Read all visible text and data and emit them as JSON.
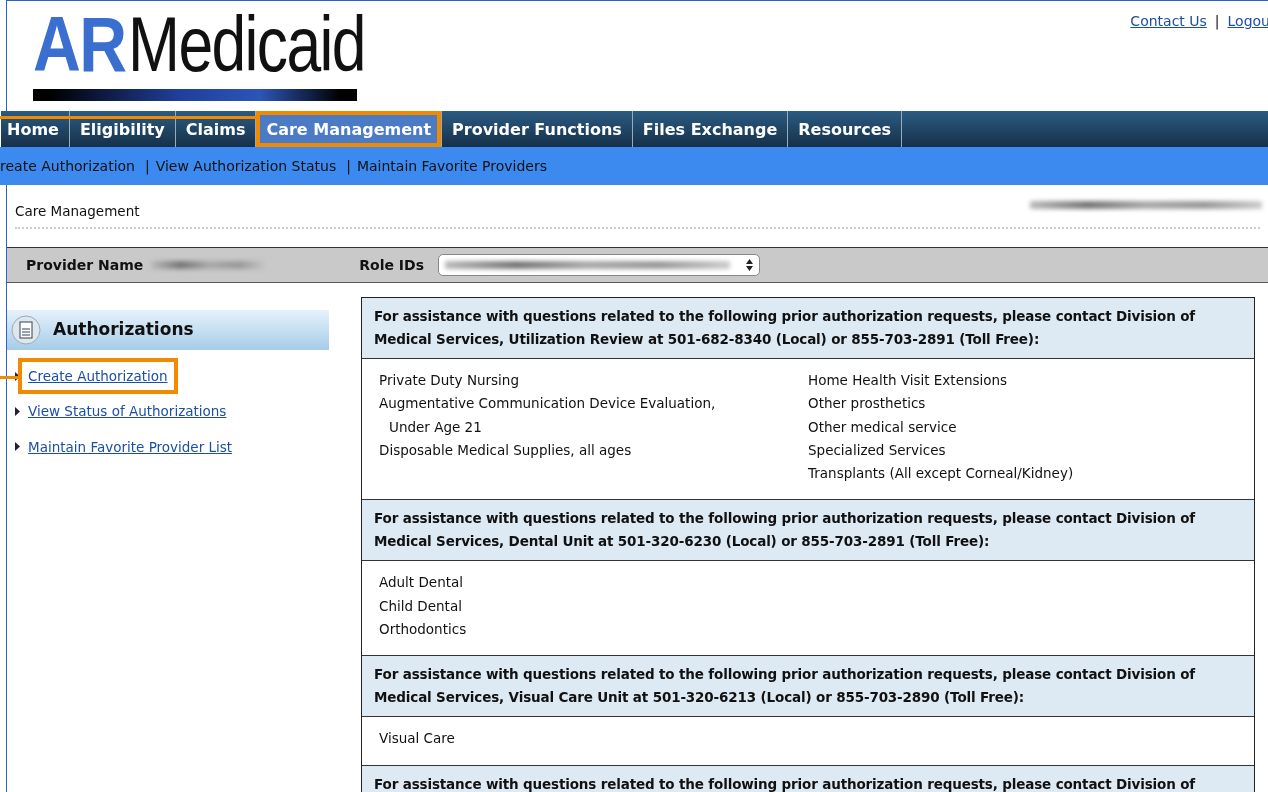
{
  "header": {
    "logo_prefix": "AR",
    "logo_name": "Medicaid",
    "links": [
      {
        "label": "Contact Us"
      },
      {
        "label": "Logou",
        "separator": "|"
      }
    ]
  },
  "nav": [
    {
      "label": "Home",
      "selected": false,
      "highlighted": false
    },
    {
      "label": "Eligibility",
      "selected": false,
      "highlighted": false
    },
    {
      "label": "Claims",
      "selected": false,
      "highlighted": false
    },
    {
      "label": "Care Management",
      "selected": true,
      "highlighted": true
    },
    {
      "label": "Provider Functions",
      "selected": false,
      "highlighted": false
    },
    {
      "label": "Files Exchange",
      "selected": false,
      "highlighted": false
    },
    {
      "label": "Resources",
      "selected": false,
      "highlighted": false
    }
  ],
  "subnav": [
    {
      "label": "reate Authorization"
    },
    {
      "label": "View Authorization Status",
      "separator": "|"
    },
    {
      "label": "Maintain Favorite Providers",
      "separator": "|"
    }
  ],
  "breadcrumb": {
    "title": "Care Management",
    "redacted": true
  },
  "provider_bar": {
    "name_label": "Provider Name",
    "name_redacted": true,
    "role_label": "Role IDs",
    "role_redacted": true
  },
  "sidebar": {
    "title": "Authorizations",
    "items": [
      {
        "label": "Create Authorization",
        "highlighted": true
      },
      {
        "label": "View Status of Authorizations",
        "highlighted": false
      },
      {
        "label": "Maintain Favorite Provider List",
        "highlighted": false
      }
    ]
  },
  "sections": [
    {
      "heading": "For assistance with questions related to the following prior authorization requests, please contact Division of Medical Services, Utilization Review at 501-682-8340 (Local) or 855-703-2891 (Toll Free):",
      "columns": [
        [
          "Private Duty Nursing",
          "Augmentative Communication Device Evaluation, Under Age 21",
          "Disposable Medical Supplies, all ages"
        ],
        [
          "Home Health Visit Extensions",
          "Other prosthetics",
          "Other medical service",
          "Specialized Services",
          "Transplants (All except Corneal/Kidney)"
        ]
      ]
    },
    {
      "heading": "For assistance with questions related to the following prior authorization requests, please contact Division of Medical Services, Dental Unit at 501-320-6230 (Local) or 855-703-2891 (Toll Free):",
      "columns": [
        [
          "Adult Dental",
          "Child Dental",
          "Orthodontics"
        ]
      ]
    },
    {
      "heading": "For assistance with questions related to the following prior authorization requests, please contact Division of Medical Services, Visual Care Unit at 501-320-6213 (Local) or 855-703-2890 (Toll Free):",
      "columns": [
        [
          "Visual Care"
        ]
      ]
    },
    {
      "heading": "For assistance with questions related to the following prior authorization requests, please contact Division of"
    }
  ]
}
